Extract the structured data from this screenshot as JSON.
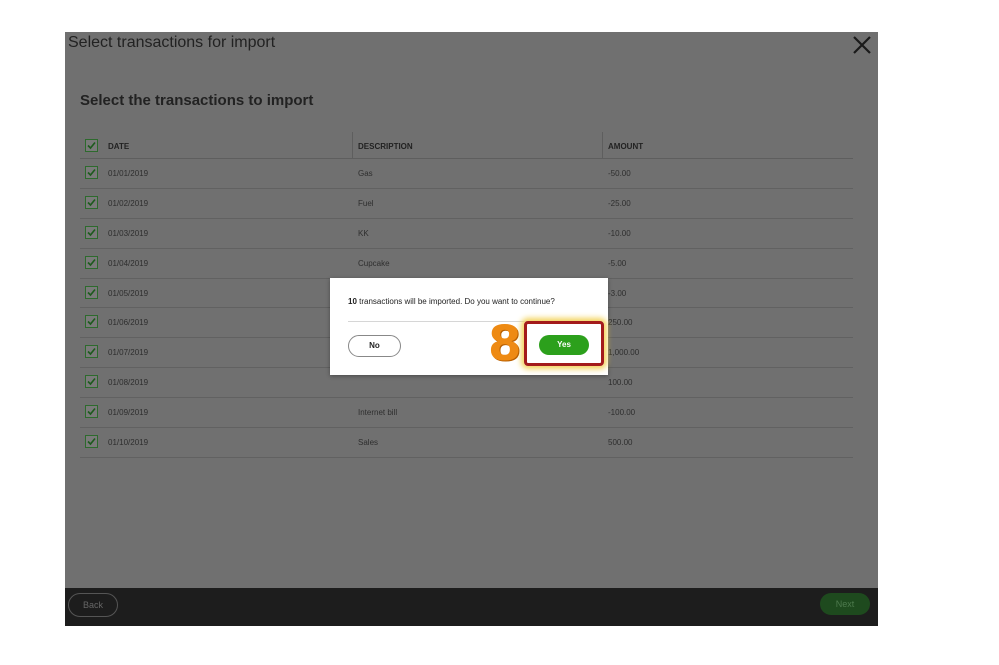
{
  "window": {
    "title": "Select transactions for import",
    "subtitle": "Select the transactions to import"
  },
  "table": {
    "headers": {
      "date": "DATE",
      "description": "DESCRIPTION",
      "amount": "AMOUNT"
    },
    "rows": [
      {
        "date": "01/01/2019",
        "description": "Gas",
        "amount": "-50.00"
      },
      {
        "date": "01/02/2019",
        "description": "Fuel",
        "amount": "-25.00"
      },
      {
        "date": "01/03/2019",
        "description": "KK",
        "amount": "-10.00"
      },
      {
        "date": "01/04/2019",
        "description": "Cupcake",
        "amount": "-5.00"
      },
      {
        "date": "01/05/2019",
        "description": "",
        "amount": "-3.00"
      },
      {
        "date": "01/06/2019",
        "description": "",
        "amount": "250.00"
      },
      {
        "date": "01/07/2019",
        "description": "",
        "amount": "1,000.00"
      },
      {
        "date": "01/08/2019",
        "description": "",
        "amount": "100.00"
      },
      {
        "date": "01/09/2019",
        "description": "Internet bill",
        "amount": "-100.00"
      },
      {
        "date": "01/10/2019",
        "description": "Sales",
        "amount": "500.00"
      }
    ]
  },
  "footer": {
    "back_label": "Back",
    "next_label": "Next"
  },
  "dialog": {
    "count": "10",
    "message": " transactions will be imported. Do you want to continue?",
    "no_label": "No",
    "yes_label": "Yes"
  },
  "annotation": {
    "step_number": "8"
  },
  "colors": {
    "accent_green": "#2ca01c",
    "highlight_red": "#a31b1b",
    "step_orange": "#ee8a13"
  },
  "icons": {
    "close": "close-icon",
    "checkbox": "checkmark-icon"
  }
}
